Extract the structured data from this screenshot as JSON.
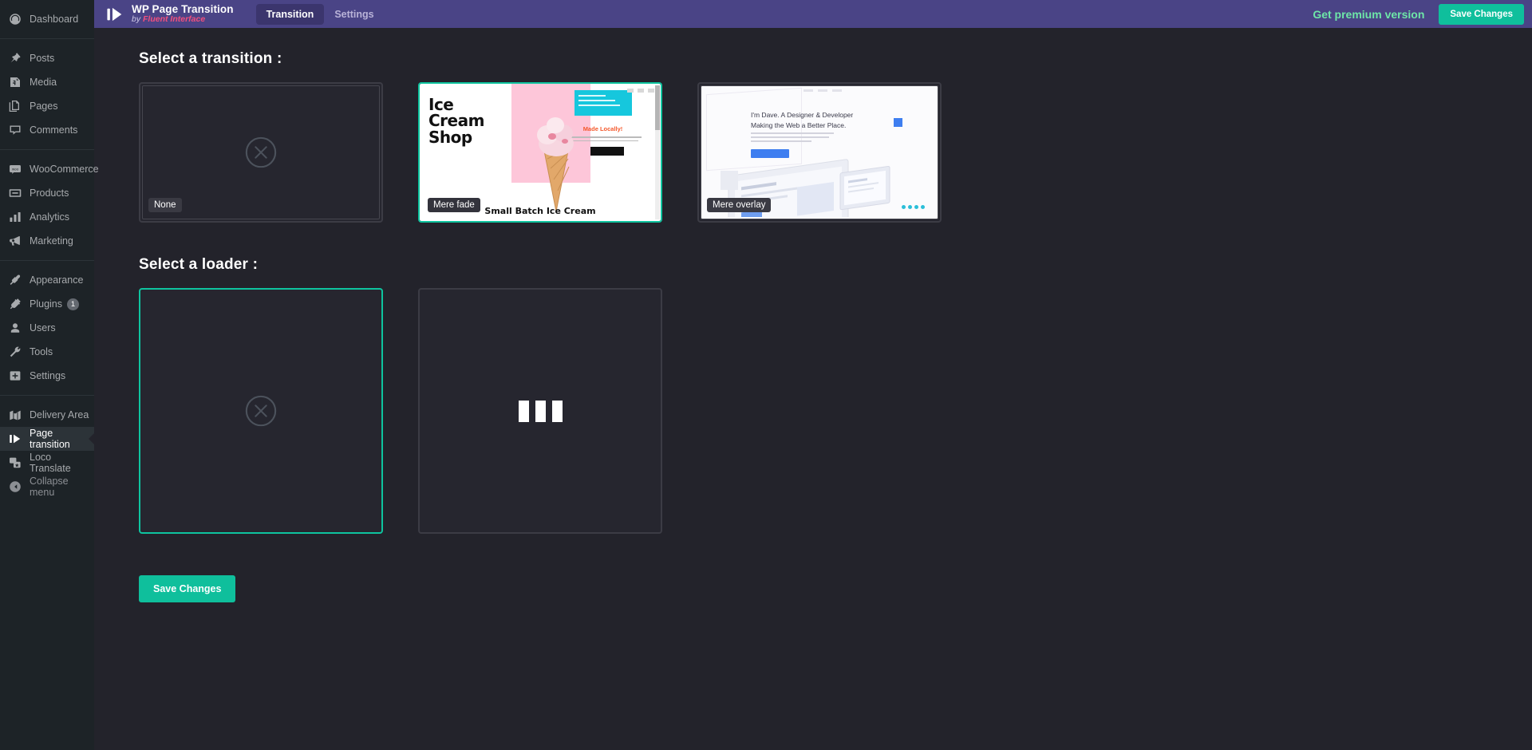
{
  "sidebar": {
    "groups": [
      {
        "items": [
          {
            "label": "Dashboard",
            "icon": "dashboard-icon"
          }
        ]
      },
      {
        "items": [
          {
            "label": "Posts",
            "icon": "pin-icon"
          },
          {
            "label": "Media",
            "icon": "media-icon"
          },
          {
            "label": "Pages",
            "icon": "pages-icon"
          },
          {
            "label": "Comments",
            "icon": "comments-icon"
          }
        ]
      },
      {
        "items": [
          {
            "label": "WooCommerce",
            "icon": "woocommerce-icon"
          },
          {
            "label": "Products",
            "icon": "products-icon"
          },
          {
            "label": "Analytics",
            "icon": "analytics-icon"
          },
          {
            "label": "Marketing",
            "icon": "marketing-icon"
          }
        ]
      },
      {
        "items": [
          {
            "label": "Appearance",
            "icon": "appearance-icon"
          },
          {
            "label": "Plugins",
            "icon": "plugins-icon",
            "badge": "1"
          },
          {
            "label": "Users",
            "icon": "users-icon"
          },
          {
            "label": "Tools",
            "icon": "tools-icon"
          },
          {
            "label": "Settings",
            "icon": "settings-icon"
          }
        ]
      },
      {
        "items": [
          {
            "label": "Delivery Area",
            "icon": "delivery-area-icon"
          },
          {
            "label": "Page transition",
            "icon": "page-transition-icon",
            "active": true
          },
          {
            "label": "Loco Translate",
            "icon": "loco-translate-icon"
          },
          {
            "label": "Collapse menu",
            "icon": "collapse-icon",
            "dim": true
          }
        ]
      }
    ]
  },
  "header": {
    "brand_title": "WP Page Transition",
    "brand_by": "by ",
    "brand_author": "Fluent Interface",
    "tabs": [
      {
        "label": "Transition",
        "active": true
      },
      {
        "label": "Settings",
        "active": false
      }
    ],
    "premium_label": "Get premium version",
    "save_label": "Save Changes"
  },
  "transition_section": {
    "title": "Select a transition :",
    "cards": [
      {
        "label": "None",
        "type": "none",
        "selected": false
      },
      {
        "label": "Mere fade",
        "type": "icecream",
        "selected": true
      },
      {
        "label": "Mere overlay",
        "type": "portfolio",
        "selected": false
      }
    ],
    "icecream_preview": {
      "title_lines": [
        "Ice",
        "Cream",
        "Shop"
      ],
      "caption": "Small Batch Ice Cream",
      "promo": "Made Locally!"
    },
    "portfolio_preview": {
      "heading_1": "I'm Dave. A Designer & Developer",
      "heading_2": "Making the Web a Better Place."
    }
  },
  "loader_section": {
    "title": "Select a loader :",
    "cards": [
      {
        "type": "none",
        "selected": true
      },
      {
        "type": "bars",
        "selected": false
      }
    ]
  },
  "footer": {
    "save_label": "Save Changes"
  },
  "colors": {
    "accent_teal": "#0ec49f",
    "header_purple": "#4a4486",
    "premium_green": "#6ee7a8",
    "author_pink": "#ef4f7e",
    "background": "#23232b"
  }
}
